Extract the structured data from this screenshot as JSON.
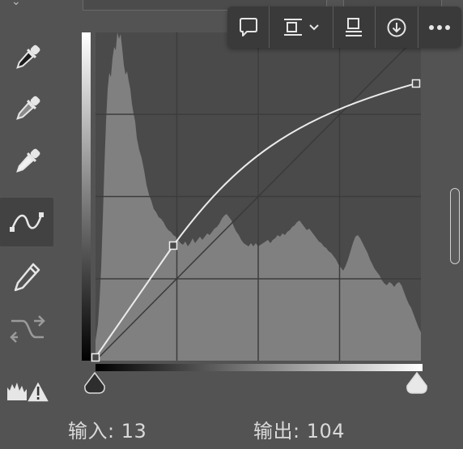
{
  "panel": {
    "input_label": "输入:",
    "input_value": "13",
    "output_label": "输出:",
    "output_value": "104"
  },
  "tools": [
    {
      "name": "eyedropper-black-point",
      "icon": "eyedropper-icon"
    },
    {
      "name": "eyedropper-gray-point",
      "icon": "eyedropper-icon"
    },
    {
      "name": "eyedropper-white-point",
      "icon": "eyedropper-icon"
    },
    {
      "name": "edit-points-curve",
      "icon": "curve-icon",
      "active": true
    },
    {
      "name": "draw-pencil",
      "icon": "pencil-icon"
    },
    {
      "name": "smooth-curve",
      "icon": "smooth-arrows-icon"
    },
    {
      "name": "clipping-warning",
      "icon": "histogram-warning-icon"
    }
  ],
  "toolbar": [
    {
      "name": "comment",
      "icon": "speech-bubble-icon"
    },
    {
      "name": "align",
      "icon": "align-dropdown-icon"
    },
    {
      "name": "distribute",
      "icon": "align-bottom-icon"
    },
    {
      "name": "download",
      "icon": "download-circle-icon"
    },
    {
      "name": "more",
      "icon": "more-dots-icon"
    }
  ],
  "colors": {
    "panel_bg": "#535353",
    "graph_bg": "#4a4a4a",
    "histogram": "#808080",
    "curve": "#ebebeb",
    "toolbar_bg": "#3a3a3a"
  },
  "curve": {
    "input_range": [
      0,
      255
    ],
    "output_range": [
      0,
      255
    ],
    "control_points": [
      {
        "input": 0,
        "output": 0
      },
      {
        "input": 61,
        "output": 89
      },
      {
        "input": 255,
        "output": 217
      }
    ],
    "selected_point": {
      "input": 13,
      "output": 104
    }
  }
}
